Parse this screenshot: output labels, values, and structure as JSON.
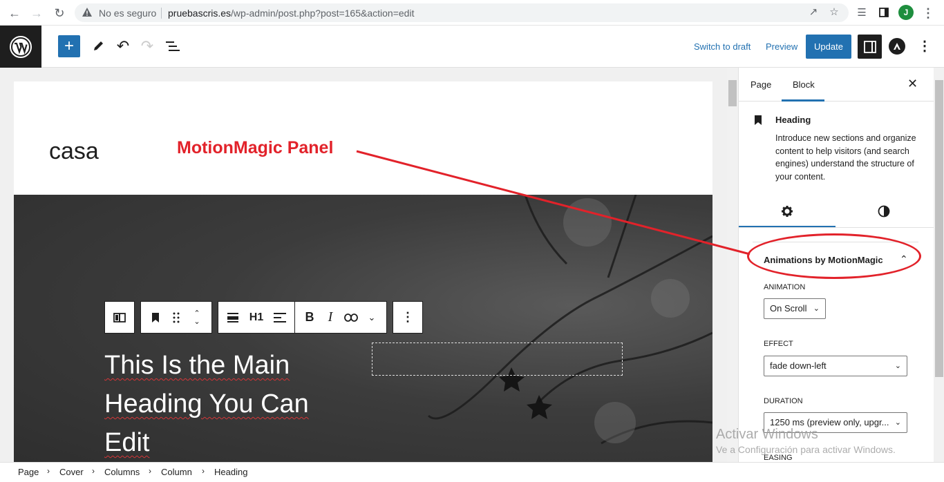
{
  "browser": {
    "insecure_label": "No es seguro",
    "url_host": "pruebascris.es",
    "url_path": "/wp-admin/post.php?post=165&action=edit",
    "profile_initial": "J"
  },
  "toolbar": {
    "switch_to_draft": "Switch to draft",
    "preview": "Preview",
    "update": "Update"
  },
  "canvas": {
    "site_title": "casa",
    "heading_lines": [
      "This Is the Main",
      "Heading You Can",
      "Edit"
    ],
    "block_toolbar": {
      "heading_level": "H1"
    }
  },
  "annotation": {
    "label": "MotionMagic Panel",
    "color": "#e2222a"
  },
  "sidebar": {
    "tabs": [
      {
        "label": "Page"
      },
      {
        "label": "Block"
      }
    ],
    "active_tab": "Block",
    "block_card": {
      "title": "Heading",
      "description": "Introduce new sections and organize content to help visitors (and search engines) understand the structure of your content."
    },
    "panel": {
      "title": "Animations by MotionMagic",
      "fields": [
        {
          "label": "ANIMATION",
          "value": "On Scroll"
        },
        {
          "label": "EFFECT",
          "value": "fade down-left"
        },
        {
          "label": "DURATION",
          "value": "1250 ms (preview only, upgr..."
        },
        {
          "label": "EASING",
          "value": ""
        }
      ]
    }
  },
  "watermark": {
    "line1": "Activar Windows",
    "line2": "Ve a Configuración para activar Windows."
  },
  "breadcrumb": [
    "Page",
    "Cover",
    "Columns",
    "Column",
    "Heading"
  ],
  "colors": {
    "accent": "#2271b1",
    "dark": "#1e1e1e",
    "annotation": "#e2222a"
  }
}
